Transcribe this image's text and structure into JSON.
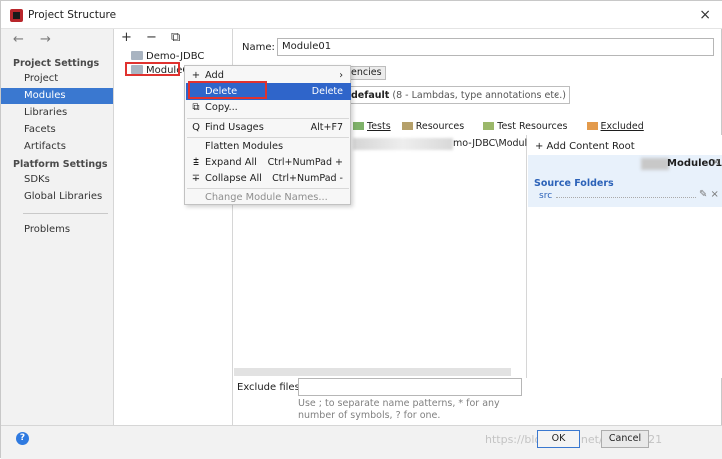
{
  "window": {
    "title": "Project Structure",
    "close_glyph": "×"
  },
  "sidebar": {
    "nav_arrows": "← →",
    "project_settings": "Project Settings",
    "items_project": [
      "Project",
      "Modules",
      "Libraries",
      "Facets",
      "Artifacts"
    ],
    "platform_settings": "Platform Settings",
    "items_platform": [
      "SDKs",
      "Global Libraries"
    ],
    "problems": "Problems",
    "selected": "Modules"
  },
  "tree": {
    "toolbar": "+ − ⧉",
    "items": [
      "Demo-JDBC",
      "ModuleO"
    ]
  },
  "module": {
    "name_label": "Name:",
    "name_value": "Module01",
    "tab_label": "encies",
    "language_level": "default",
    "language_level_hint": "(8 - Lambdas, type annotations etc.)",
    "mark_as": [
      "Tests",
      "Resources",
      "Test Resources",
      "Excluded"
    ],
    "path_fragment": "mo-JDBC\\Modul",
    "add_content_root": "+ Add Content Root",
    "root_title": "Module01",
    "source_folders": "Source Folders",
    "src": "src",
    "exclude_label": "Exclude files:",
    "exclude_value": "",
    "exclude_help": "Use ; to separate name patterns, * for any number of symbols, ? for one."
  },
  "context_menu": {
    "items": [
      {
        "icon": "+",
        "label": "Add",
        "shortcut": "›",
        "state": "normal"
      },
      {
        "icon": "",
        "label": "Delete",
        "shortcut": "Delete",
        "state": "highlighted"
      },
      {
        "icon": "⧉",
        "label": "Copy...",
        "shortcut": "",
        "state": "normal"
      },
      {
        "icon": "🔍",
        "label": "Find Usages",
        "shortcut": "Alt+F7",
        "state": "normal"
      },
      {
        "icon": "",
        "label": "Flatten Modules",
        "shortcut": "",
        "state": "normal"
      },
      {
        "icon": "⇲",
        "label": "Expand All",
        "shortcut": "Ctrl+NumPad +",
        "state": "normal"
      },
      {
        "icon": "⇱",
        "label": "Collapse All",
        "shortcut": "Ctrl+NumPad -",
        "state": "normal"
      },
      {
        "icon": "",
        "label": "Change Module Names...",
        "shortcut": "",
        "state": "disabled"
      }
    ]
  },
  "footer": {
    "help": "?",
    "ok": "OK",
    "cancel": "Cancel",
    "watermark": "https://blog.csdn.net/...1263821"
  },
  "colors": {
    "selection": "#3a78d0",
    "menu_highlight": "#2f65ca",
    "annotation_red": "#e0322f",
    "source_blue": "#2c62b8"
  }
}
